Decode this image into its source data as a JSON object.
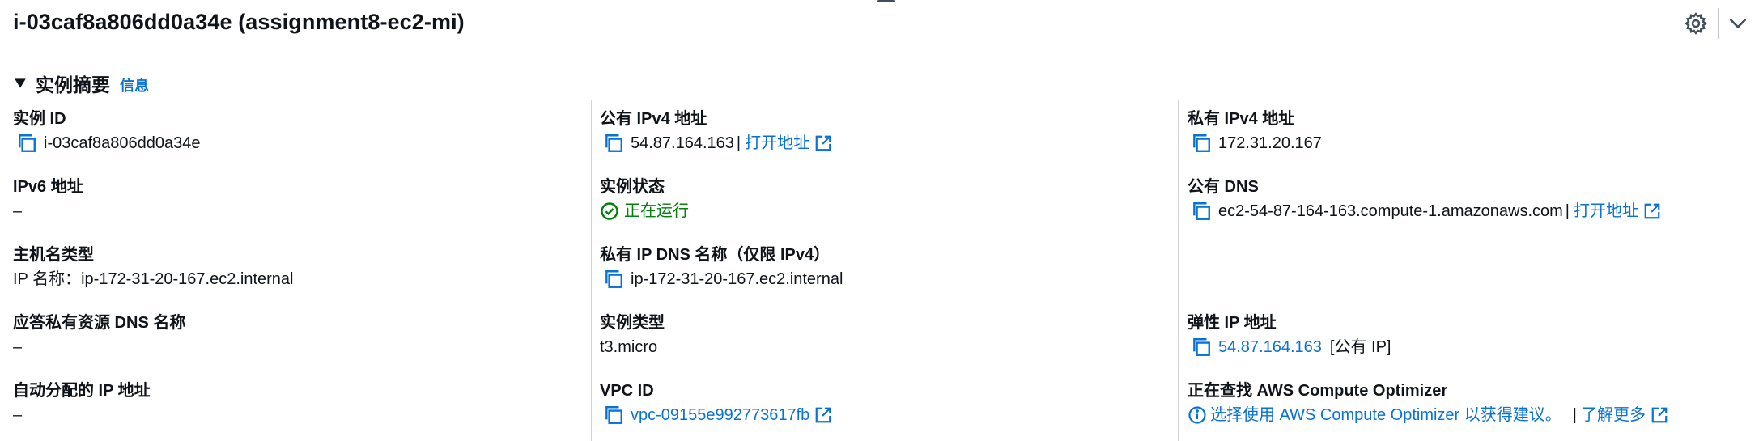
{
  "header": {
    "title": "i-03caf8a806dd0a34e (assignment8-ec2-mi)"
  },
  "summary": {
    "section_title": "实例摘要",
    "info_link": "信息"
  },
  "fields": {
    "instance_id": {
      "label": "实例 ID",
      "value": "i-03caf8a806dd0a34e"
    },
    "ipv6": {
      "label": "IPv6 地址",
      "value": "–"
    },
    "hostname_type": {
      "label": "主机名类型",
      "value": "IP 名称：ip-172-31-20-167.ec2.internal"
    },
    "answer_private_dns": {
      "label": "应答私有资源 DNS 名称",
      "value": "–"
    },
    "auto_ip": {
      "label": "自动分配的 IP 地址",
      "value": "–"
    },
    "public_ipv4": {
      "label": "公有 IPv4 地址",
      "value": "54.87.164.163",
      "separator": "|",
      "open_link": "打开地址"
    },
    "instance_state": {
      "label": "实例状态",
      "value": "正在运行"
    },
    "private_ip_dns": {
      "label": "私有 IP DNS 名称（仅限 IPv4）",
      "value": "ip-172-31-20-167.ec2.internal"
    },
    "instance_type": {
      "label": "实例类型",
      "value": "t3.micro"
    },
    "vpc_id": {
      "label": "VPC ID",
      "value": "vpc-09155e992773617fb"
    },
    "private_ipv4": {
      "label": "私有 IPv4 地址",
      "value": "172.31.20.167"
    },
    "public_dns": {
      "label": "公有 DNS",
      "value": "ec2-54-87-164-163.compute-1.amazonaws.com",
      "separator": "|",
      "open_link": "打开地址"
    },
    "elastic_ip": {
      "label": "弹性 IP 地址",
      "value": "54.87.164.163",
      "suffix": "[公有 IP]"
    },
    "optimizer": {
      "label": "正在查找 AWS Compute Optimizer",
      "value": "选择使用 AWS Compute Optimizer 以获得建议。",
      "separator": "|",
      "learn_more": "了解更多"
    }
  },
  "colors": {
    "link": "#0972d3",
    "success": "#037f0c",
    "text": "#0f141a"
  },
  "icons": [
    "gear-icon",
    "chevron-down-icon",
    "caret-down-icon",
    "copy-icon",
    "external-link-icon",
    "status-check-icon",
    "info-icon"
  ]
}
